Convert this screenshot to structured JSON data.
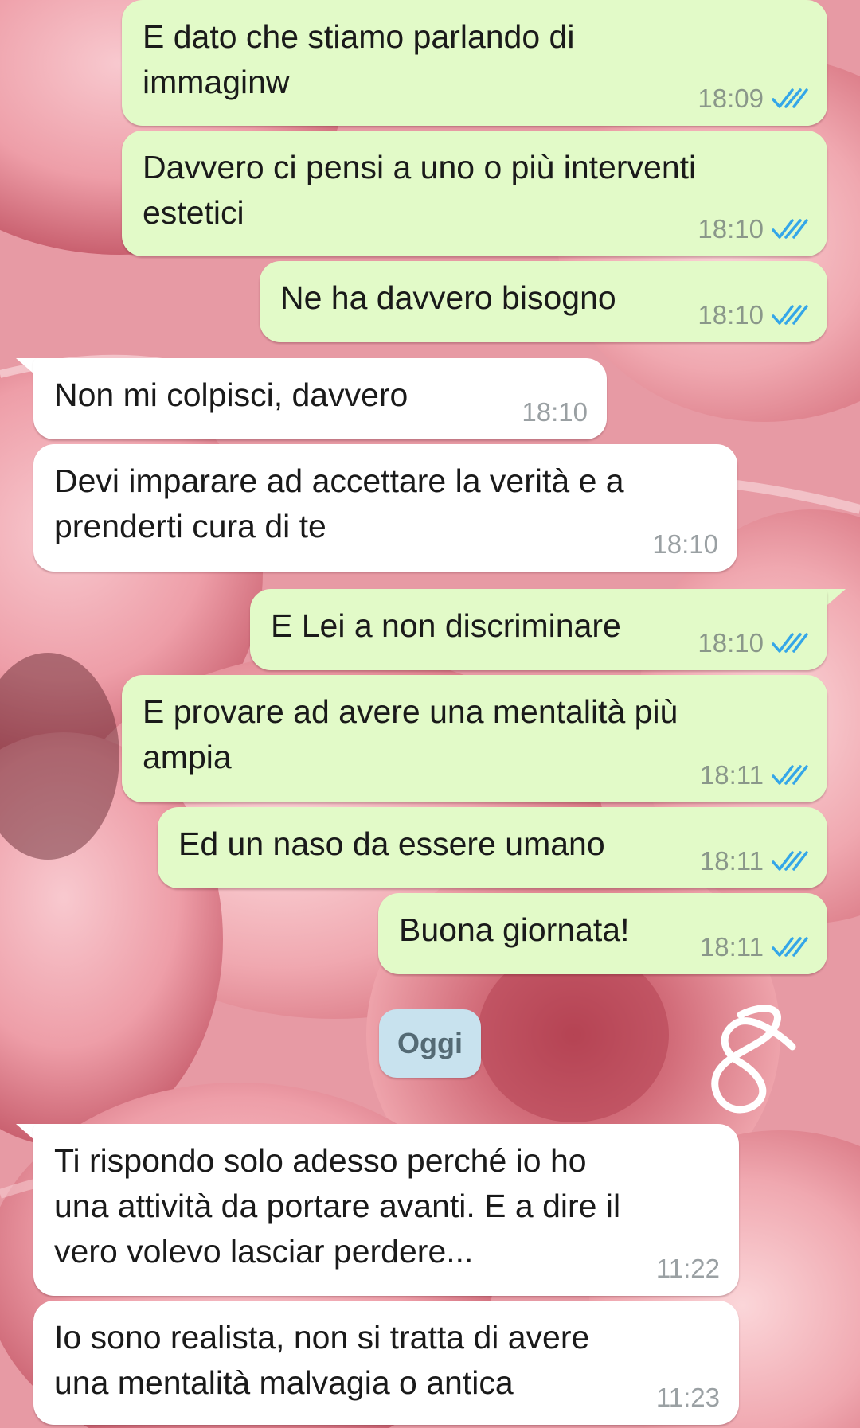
{
  "wallpaper": {
    "description_color": "#e98f9a"
  },
  "colors": {
    "outgoing_bubble": "#e2fac8",
    "incoming_bubble": "#ffffff",
    "read_ticks": "#34a6e8",
    "date_chip": "#c8e2ee"
  },
  "messages": [
    {
      "direction": "out",
      "text": "E dato che stiamo parlando di\nimmaginw",
      "time": "18:09",
      "read": true
    },
    {
      "direction": "out",
      "text": "Davvero ci pensi a uno o più interventi\nestetici",
      "time": "18:10",
      "read": true
    },
    {
      "direction": "out",
      "text": "Ne ha davvero bisogno",
      "time": "18:10",
      "read": true
    },
    {
      "direction": "in",
      "text": "Non mi colpisci, davvero",
      "time": "18:10"
    },
    {
      "direction": "in",
      "text": "Devi imparare ad accettare la verità e a\nprenderti cura di te",
      "time": "18:10"
    },
    {
      "direction": "out",
      "text": "E Lei a non discriminare",
      "time": "18:10",
      "read": true
    },
    {
      "direction": "out",
      "text": "E provare ad avere una mentalità più\nampia",
      "time": "18:11",
      "read": true
    },
    {
      "direction": "out",
      "text": "Ed un naso da essere umano",
      "time": "18:11",
      "read": true
    },
    {
      "direction": "out",
      "text": "Buona giornata!",
      "time": "18:11",
      "read": true
    },
    {
      "direction": "in",
      "text": "Ti rispondo solo adesso perché io ho\nuna attività da portare avanti. E a dire il\nvero volevo lasciar perdere...",
      "time": "11:22"
    },
    {
      "direction": "in",
      "text": "Io sono realista, non si tratta di avere\nuna mentalità malvagia o antica",
      "time": "11:23"
    }
  ],
  "date_separator": {
    "label": "Oggi"
  },
  "annotation": {
    "icon": "handwritten-scribble-icon"
  }
}
